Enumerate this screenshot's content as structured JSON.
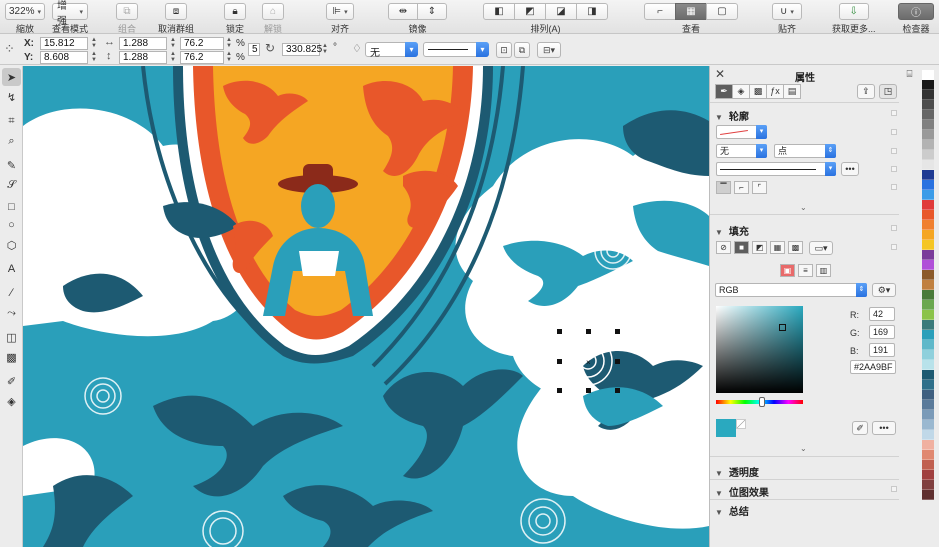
{
  "toolbar": {
    "zoom": {
      "value": "322%",
      "label": "縮放"
    },
    "view_mode": {
      "value": "增强",
      "label": "查看模式"
    },
    "group_label": "组合",
    "ungroup_label": "取消群组",
    "lock_label": "锁定",
    "unlock_label": "解锁",
    "align_label": "对齐",
    "mirror_label": "镜像",
    "arrange_label": "排列(A)",
    "view_label": "查看",
    "snap_label": "贴齐",
    "get_more_label": "获取更多...",
    "inspector_label": "检查器",
    "icons": [
      "group-icon",
      "ungroup-icon",
      "lock-icon",
      "unlock-icon",
      "align-icon",
      "mirror-icon",
      "arrange-icon",
      "view-icon",
      "snap-icon",
      "download-icon",
      "info-icon"
    ]
  },
  "propbar": {
    "x_label": "X:",
    "y_label": "Y:",
    "x_value": "15.812",
    "y_value": "8.608",
    "width_value": "1.288",
    "height_value": "1.288",
    "scale_x": "76.2",
    "scale_y": "76.2",
    "percent": "%",
    "angle_value": "330.825",
    "degree": "°",
    "fill_value": "无",
    "small_value": "5"
  },
  "docker": {
    "title": "属性",
    "outline": {
      "title": "轮廓",
      "width_value": "无",
      "unit_value": "点"
    },
    "fill": {
      "title": "填充",
      "model": "RGB",
      "r_label": "R:",
      "g_label": "G:",
      "b_label": "B:",
      "r": "42",
      "g": "169",
      "b": "191",
      "hex": "#2AA9BF"
    },
    "transparency_title": "透明度",
    "bitmap_effects_title": "位图效果",
    "summary_title": "总结",
    "more": "•••"
  },
  "colors": {
    "accent": "#2a72e0",
    "fill_color": "#2AA9BF",
    "artwork_teal": "#2a9fba",
    "artwork_dark": "#1d5a72",
    "artwork_orange": "#e8572a",
    "artwork_yellow": "#f5a623"
  },
  "palette": [
    "#ffffff",
    "#1a1a1a",
    "#333333",
    "#4d4d4d",
    "#666666",
    "#808080",
    "#999999",
    "#b3b3b3",
    "#cccccc",
    "#e6e6e6",
    "#1f3a93",
    "#2a72e0",
    "#3b9ce8",
    "#e03a3a",
    "#e8572a",
    "#f08030",
    "#f5a623",
    "#f5c623",
    "#7a3c9a",
    "#b04fd8",
    "#8b5a2b",
    "#c08040",
    "#4a7a3a",
    "#6aa84f",
    "#8bc34a",
    "#3a7a7a",
    "#2a9fba",
    "#5fb8c9",
    "#8fd0dc",
    "#b8e2ea",
    "#1d5a72",
    "#2e6f8a",
    "#406080",
    "#5a7a9a",
    "#7a9ab8",
    "#9ab8d0",
    "#c0d8e8",
    "#f0b0a0",
    "#e08870",
    "#c06050",
    "#a04040",
    "#804040",
    "#603030"
  ]
}
